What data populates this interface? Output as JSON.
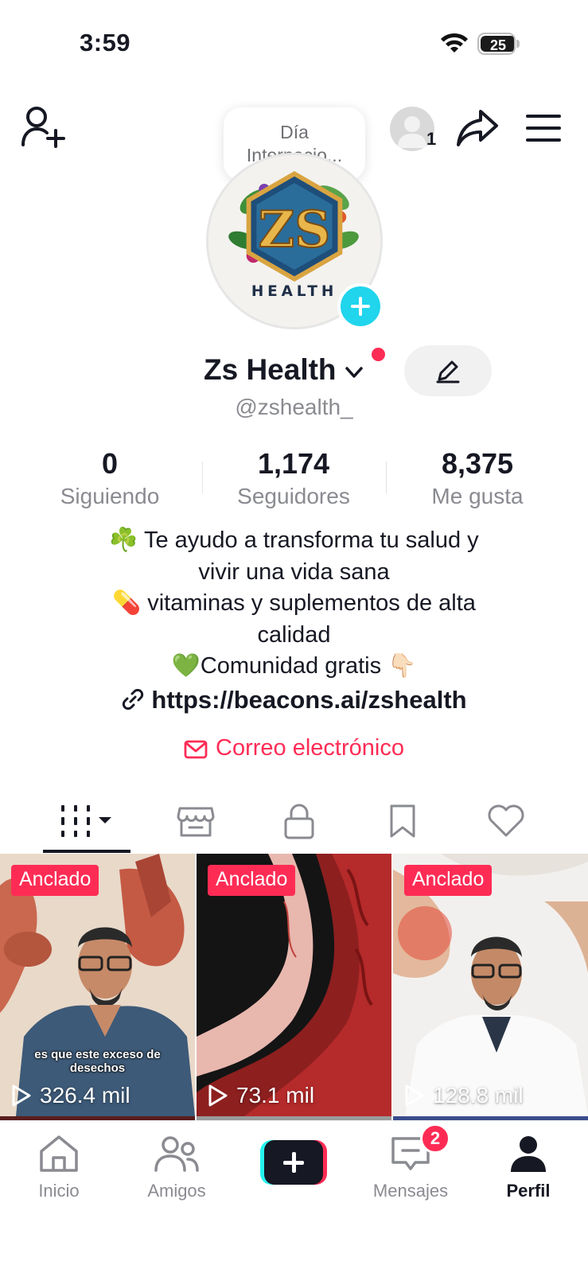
{
  "status_bar": {
    "time": "3:59",
    "battery": "25",
    "battery_level": 0.25
  },
  "header": {
    "story_note": "Día Internacio...",
    "viewer_count": "1"
  },
  "profile": {
    "display_name": "Zs Health",
    "username": "@zshealth_",
    "avatar_text": "ZS",
    "avatar_subtext": "HEALTH"
  },
  "stats": [
    {
      "value": "0",
      "label": "Siguiendo"
    },
    {
      "value": "1,174",
      "label": "Seguidores"
    },
    {
      "value": "8,375",
      "label": "Me gusta"
    }
  ],
  "bio": {
    "lines": [
      "☘️ Te ayudo a transforma tu salud y",
      "vivir una vida sana",
      "💊 vitaminas y suplementos de alta",
      "calidad",
      "💚Comunidad gratis 👇🏻"
    ],
    "link": "https://beacons.ai/zshealth",
    "email_label": "Correo electrónico"
  },
  "tabs": [
    "videos-tab",
    "shop-tab",
    "private-tab",
    "saved-tab",
    "liked-tab"
  ],
  "videos": [
    {
      "badge": "Anclado",
      "views": "326.4 mil",
      "caption": "es que este exceso de desechos"
    },
    {
      "badge": "Anclado",
      "views": "73.1 mil",
      "caption": ""
    },
    {
      "badge": "Anclado",
      "views": "128.8 mil",
      "caption": ""
    }
  ],
  "nav": {
    "home": "Inicio",
    "friends": "Amigos",
    "messages": "Mensajes",
    "messages_badge": "2",
    "profile": "Perfil"
  },
  "colors": {
    "accent": "#fe2c55",
    "cyan": "#20d5ec",
    "text": "#161823",
    "muted": "#8a8b91"
  }
}
